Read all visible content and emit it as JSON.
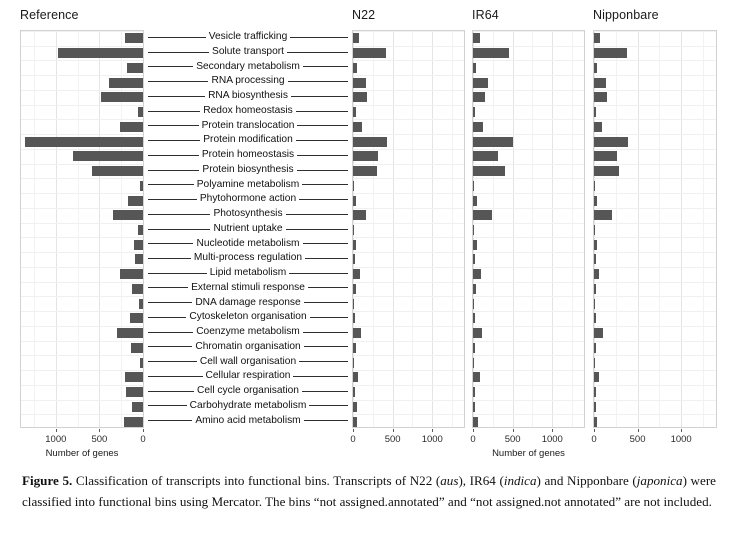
{
  "figure": {
    "categories": [
      "Vesicle trafficking",
      "Solute transport",
      "Secondary metabolism",
      "RNA processing",
      "RNA biosynthesis",
      "Redox homeostasis",
      "Protein translocation",
      "Protein modification",
      "Protein homeostasis",
      "Protein biosynthesis",
      "Polyamine metabolism",
      "Phytohormone action",
      "Photosynthesis",
      "Nutrient uptake",
      "Nucleotide metabolism",
      "Multi-process regulation",
      "Lipid metabolism",
      "External stimuli response",
      "DNA damage response",
      "Cytoskeleton organisation",
      "Coenzyme metabolism",
      "Chromatin organisation",
      "Cell wall organisation",
      "Cellular respiration",
      "Cell cycle organisation",
      "Carbohydrate metabolism",
      "Amino acid metabolism"
    ],
    "panels": [
      {
        "title": "Reference",
        "reversed": true,
        "axis_title": "Number of genes",
        "ticks": [
          1000,
          500,
          0
        ]
      },
      {
        "title": "N22",
        "reversed": false,
        "axis_title": "",
        "ticks": [
          0,
          500,
          1000
        ]
      },
      {
        "title": "IR64",
        "reversed": false,
        "axis_title": "Number of genes",
        "ticks": [
          0,
          500,
          1000
        ]
      },
      {
        "title": "Nipponbare",
        "reversed": false,
        "axis_title": "",
        "ticks": [
          0,
          500,
          1000
        ]
      }
    ]
  },
  "chart_data": {
    "type": "bar",
    "title": "Classification of transcripts into functional bins",
    "xlabel": "Number of genes",
    "ylabel": "",
    "xlim": [
      0,
      1400
    ],
    "grid": true,
    "orientation": "horizontal",
    "legend": "none",
    "bar_color": "#565656",
    "categories": [
      "Vesicle trafficking",
      "Solute transport",
      "Secondary metabolism",
      "RNA processing",
      "RNA biosynthesis",
      "Redox homeostasis",
      "Protein translocation",
      "Protein modification",
      "Protein homeostasis",
      "Protein biosynthesis",
      "Polyamine metabolism",
      "Phytohormone action",
      "Photosynthesis",
      "Nutrient uptake",
      "Nucleotide metabolism",
      "Multi-process regulation",
      "Lipid metabolism",
      "External stimuli response",
      "DNA damage response",
      "Cytoskeleton organisation",
      "Coenzyme metabolism",
      "Chromatin organisation",
      "Cell wall organisation",
      "Cellular respiration",
      "Cell cycle organisation",
      "Carbohydrate metabolism",
      "Amino acid metabolism"
    ],
    "series": [
      {
        "name": "Reference",
        "axis_reversed": true,
        "values": [
          210,
          980,
          185,
          390,
          480,
          60,
          260,
          1350,
          800,
          590,
          30,
          175,
          350,
          60,
          100,
          90,
          265,
          125,
          45,
          150,
          300,
          135,
          40,
          205,
          200,
          130,
          215
        ]
      },
      {
        "name": "N22",
        "axis_reversed": false,
        "values": [
          75,
          410,
          50,
          160,
          180,
          35,
          115,
          425,
          310,
          305,
          10,
          40,
          165,
          15,
          40,
          30,
          90,
          35,
          5,
          20,
          95,
          35,
          8,
          60,
          30,
          45,
          55
        ]
      },
      {
        "name": "IR64",
        "axis_reversed": false,
        "values": [
          85,
          450,
          35,
          195,
          155,
          30,
          120,
          500,
          315,
          400,
          12,
          45,
          235,
          18,
          45,
          20,
          100,
          35,
          6,
          22,
          110,
          30,
          10,
          85,
          30,
          30,
          60
        ]
      },
      {
        "name": "Nipponbare",
        "axis_reversed": false,
        "values": [
          65,
          380,
          30,
          140,
          150,
          25,
          90,
          395,
          265,
          285,
          10,
          40,
          205,
          15,
          35,
          18,
          60,
          25,
          5,
          18,
          100,
          25,
          8,
          55,
          22,
          25,
          40
        ]
      }
    ]
  },
  "caption": {
    "label": "Figure 5.",
    "part1": " Classification of transcripts into functional bins. Transcripts of N22 (",
    "it1": "aus",
    "part2": "), IR64 (",
    "it2": "indica",
    "part3": ") and Nipponbare (",
    "it3": "japonica",
    "part4": ") were classified into functional bins using Mercator. The bins “not assigned.annotated” and “not assigned.not annotated” are not included."
  }
}
